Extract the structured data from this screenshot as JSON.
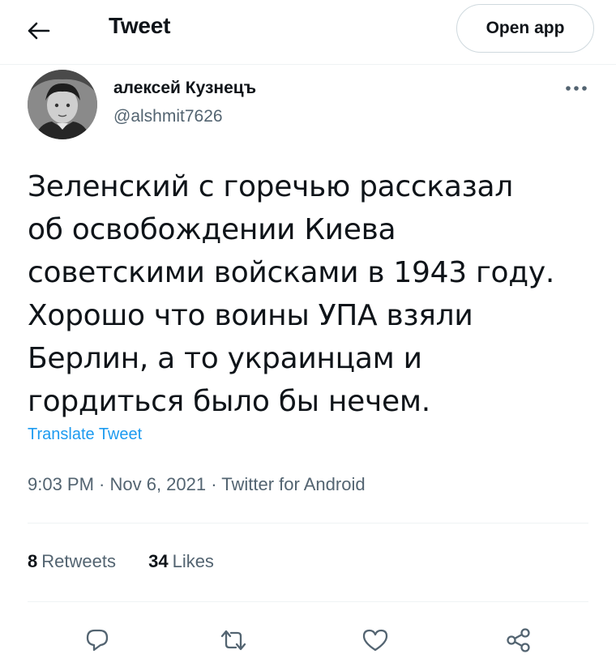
{
  "header": {
    "title": "Tweet",
    "open_app_label": "Open app",
    "back_icon": "arrow-left-icon"
  },
  "tweet": {
    "author": {
      "display_name": "алексей Кузнецъ",
      "handle": "@alshmit7626"
    },
    "text": "Зеленский с горечью рассказал\nоб освобождении Киева\nсоветскими войсками в 1943 году.\nХорошо что воины УПА взяли\nБерлин, а то украинцам и\nгордиться было бы нечем.",
    "translate_label": "Translate Tweet",
    "meta": "9:03 PM · Nov 6, 2021 · Twitter for Android",
    "retweets_count": "8",
    "retweets_label": "Retweets",
    "likes_count": "34",
    "likes_label": "Likes"
  },
  "actions": [
    "reply-icon",
    "retweet-icon",
    "like-icon",
    "share-icon"
  ],
  "colors": {
    "link_blue": "#1d9bf0",
    "secondary_text": "#536471",
    "primary_text": "#0f1419",
    "divider": "#eff3f4"
  }
}
